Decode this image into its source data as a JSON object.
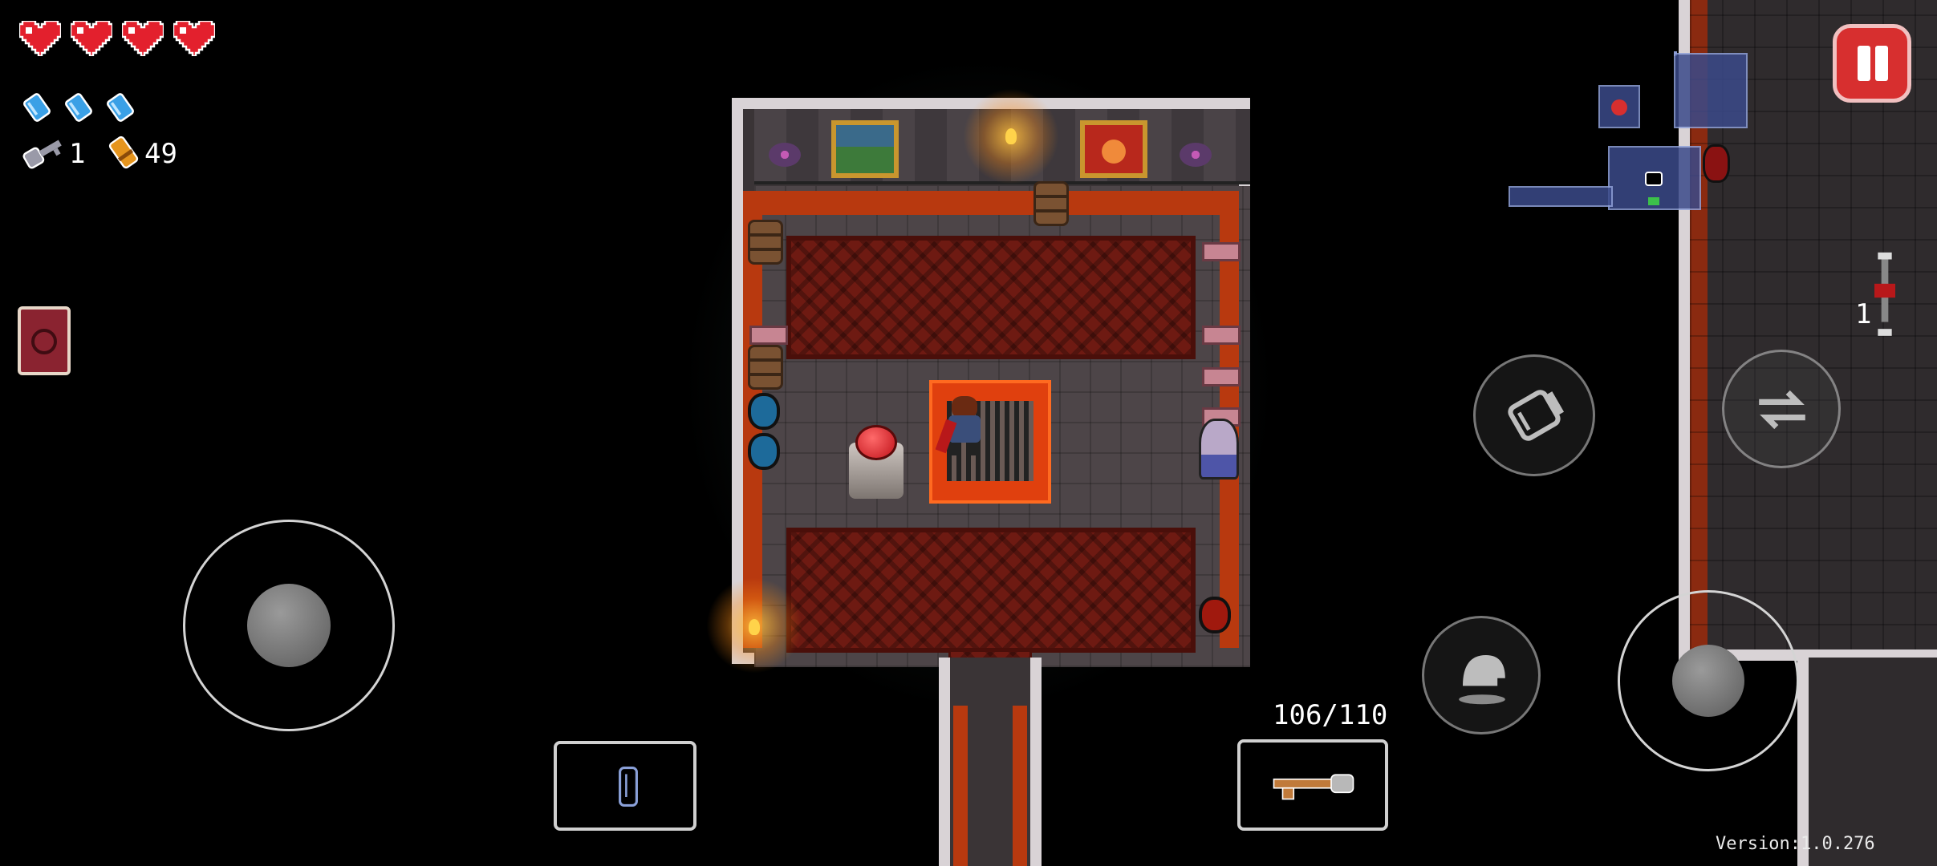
{
  "hud": {
    "hearts": [
      {
        "icon": "full-heart-icon"
      },
      {
        "icon": "full-heart-icon"
      },
      {
        "icon": "full-heart-icon"
      },
      {
        "icon": "full-heart-icon"
      }
    ],
    "blanks": [
      {
        "icon": "blank-icon"
      },
      {
        "icon": "blank-icon"
      },
      {
        "icon": "blank-icon"
      }
    ],
    "keys_count": "1",
    "shells_count": "49",
    "active_item_icon": "spellbook-icon",
    "ammo_display": "106/110",
    "secondary_item_count": "1",
    "version_label": "Version:1.0.276"
  },
  "controls": {
    "pause_icon": "pause-icon",
    "reload_icon": "reload-icon",
    "swap_weapon_icon": "swap-weapon-icon",
    "dodge_roll_icon": "dodge-roll-icon",
    "blank_slot_icon": "blank-item-icon",
    "gun_slot_icon": "gun-icon"
  },
  "colors": {
    "heart": "#e3202d",
    "blank": "#3aa0e6",
    "pause_button": "#d72f2f",
    "lava_trim": "#b8390f",
    "carpet": "#6e1a12",
    "wall_trim": "#d9d3d6"
  }
}
